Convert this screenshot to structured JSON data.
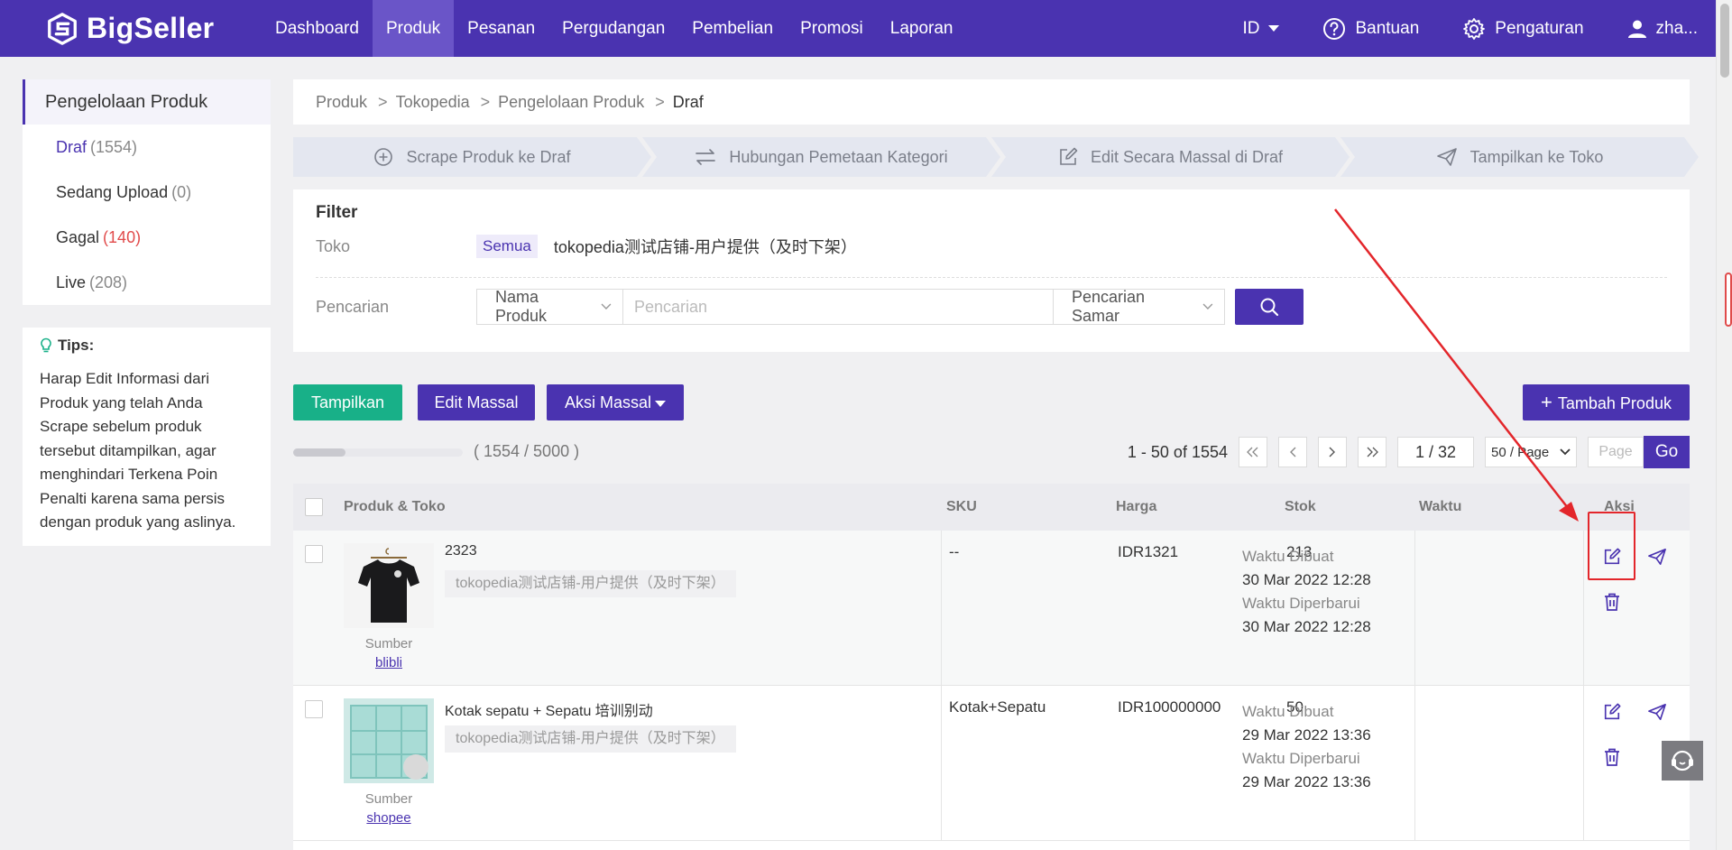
{
  "app": {
    "logo_text": "BigSeller"
  },
  "nav": [
    {
      "label": "Dashboard"
    },
    {
      "label": "Produk"
    },
    {
      "label": "Pesanan"
    },
    {
      "label": "Pergudangan"
    },
    {
      "label": "Pembelian"
    },
    {
      "label": "Promosi"
    },
    {
      "label": "Laporan"
    }
  ],
  "top_right": {
    "language": "ID",
    "help": "Bantuan",
    "settings": "Pengaturan",
    "user": "zha..."
  },
  "sidebar": {
    "title": "Pengelolaan Produk",
    "items": [
      {
        "label": "Draf",
        "count": "(1554)"
      },
      {
        "label": "Sedang Upload",
        "count": "(0)"
      },
      {
        "label": "Gagal",
        "count": "(140)"
      },
      {
        "label": "Live",
        "count": "(208)"
      }
    ]
  },
  "tips": {
    "title": "Tips:",
    "text": "Harap Edit Informasi dari Produk yang telah Anda Scrape sebelum produk tersebut ditampilkan, agar menghindari Terkena Poin Penalti karena sama persis dengan produk yang aslinya."
  },
  "breadcrumb": {
    "items": [
      "Produk",
      "Tokopedia",
      "Pengelolaan Produk"
    ],
    "current": "Draf",
    "separator": ">"
  },
  "steps": [
    {
      "label": "Scrape Produk ke Draf",
      "icon": "plus-circle-icon"
    },
    {
      "label": "Hubungan Pemetaan Kategori",
      "icon": "swap-arrows-icon"
    },
    {
      "label": "Edit Secara Massal di Draf",
      "icon": "edit-icon"
    },
    {
      "label": "Tampilkan ke Toko",
      "icon": "send-icon"
    }
  ],
  "filter": {
    "title": "Filter",
    "store_label": "Toko",
    "store_all": "Semua",
    "store_name": "tokopedia测试店铺-用户提供（及时下架）",
    "search_label": "Pencarian",
    "search_field": "Nama Produk",
    "search_placeholder": "Pencarian",
    "search_mode": "Pencarian Samar"
  },
  "actions": {
    "publish": "Tampilkan",
    "bulk_edit": "Edit Massal",
    "bulk_action": "Aksi Massal",
    "add_product": "Tambah Produk"
  },
  "quota": {
    "text": "( 1554 / 5000 )",
    "used": 1554,
    "total": 5000
  },
  "pagination": {
    "range": "1 - 50 of 1554",
    "page": "1 / 32",
    "page_size": "50 / Page",
    "goto_placeholder": "Page",
    "go": "Go"
  },
  "table": {
    "headers": {
      "product": "Produk & Toko",
      "sku": "SKU",
      "price": "Harga",
      "stock": "Stok",
      "time": "Waktu",
      "action": "Aksi"
    },
    "rows": [
      {
        "name": "2323",
        "store": "tokopedia测试店铺-用户提供（及时下架）",
        "source_label": "Sumber",
        "source": "blibli",
        "sku": "--",
        "price": "IDR1321",
        "stock": "213",
        "created_label": "Waktu Dibuat",
        "created": "30 Mar 2022 12:28",
        "updated_label": "Waktu Diperbarui",
        "updated": "30 Mar 2022 12:28"
      },
      {
        "name": "Kotak sepatu + Sepatu 培训别动",
        "store": "tokopedia测试店铺-用户提供（及时下架）",
        "source_label": "Sumber",
        "source": "shopee",
        "sku": "Kotak+Sepatu",
        "price": "IDR100000000",
        "stock": "50",
        "created_label": "Waktu Dibuat",
        "created": "29 Mar 2022 13:36",
        "updated_label": "Waktu Diperbarui",
        "updated": "29 Mar 2022 13:36"
      }
    ]
  },
  "colors": {
    "brand": "#4a33b0",
    "green": "#18b088",
    "red_annotation": "#e3262b",
    "count_red": "#e14b4b"
  }
}
